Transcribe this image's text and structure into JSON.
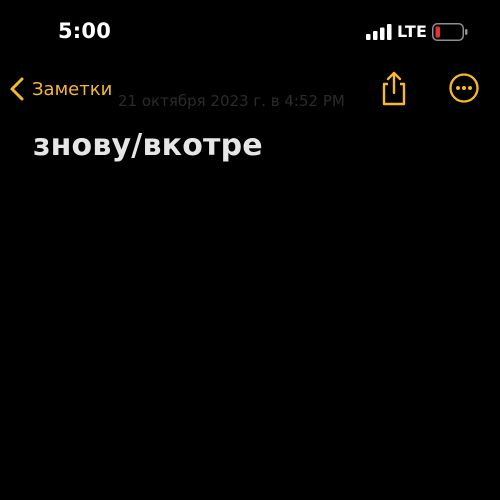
{
  "status_bar": {
    "time": "5:00",
    "network": "LTE",
    "signal_bars": 4,
    "battery_level": "low",
    "battery_color": "#e5332a"
  },
  "nav": {
    "back_label": "Заметки",
    "date": "21 октября 2023 г. в 4:52 PM",
    "accent_color": "#f5b82e",
    "share_icon": "share-icon",
    "more_icon": "ellipsis-circle-icon"
  },
  "note": {
    "title": "знову/вкотре"
  }
}
